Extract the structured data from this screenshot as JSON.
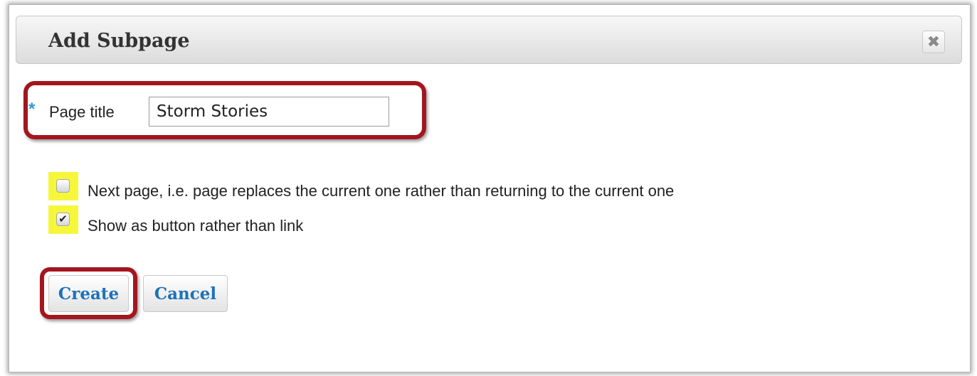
{
  "dialog": {
    "title": "Add Subpage",
    "close_icon": "close-icon"
  },
  "form": {
    "required_marker": "*",
    "page_title_label": "Page title",
    "page_title_value": "Storm Stories",
    "options": [
      {
        "label": "Next page, i.e. page replaces the current one rather than returning to the current one",
        "checked": false
      },
      {
        "label": "Show as button rather than link",
        "checked": true
      }
    ]
  },
  "actions": {
    "create_label": "Create",
    "cancel_label": "Cancel"
  },
  "colors": {
    "highlight_outline": "#a3161e",
    "checkbox_highlight": "#f6f73a",
    "button_text": "#1d72b8",
    "required_marker": "#2c9ad8"
  }
}
